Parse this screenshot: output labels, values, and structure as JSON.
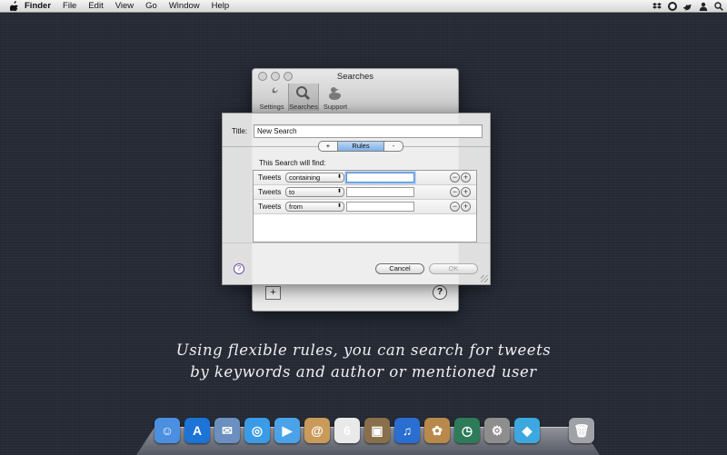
{
  "menubar": {
    "app_name": "Finder",
    "menus": [
      "File",
      "Edit",
      "View",
      "Go",
      "Window",
      "Help"
    ],
    "status_icons": [
      "dropbox-icon",
      "lifebuoy-icon",
      "bird-icon",
      "user-icon",
      "spotlight-icon"
    ]
  },
  "prefs_window": {
    "title": "Searches",
    "toolbar": [
      {
        "label": "Settings",
        "icon": "wrench-icon"
      },
      {
        "label": "Searches",
        "icon": "magnifier-icon"
      },
      {
        "label": "Support",
        "icon": "duck-icon"
      }
    ],
    "add_label": "+",
    "help_label": "?"
  },
  "sheet": {
    "title_label": "Title:",
    "title_value": "New Search",
    "segments": {
      "plus": "+",
      "rules": "Rules",
      "minus": "-"
    },
    "find_label": "This Search will find:",
    "rules": [
      {
        "label": "Tweets",
        "operator": "containing",
        "value": ""
      },
      {
        "label": "Tweets",
        "operator": "to",
        "value": ""
      },
      {
        "label": "Tweets",
        "operator": "from",
        "value": ""
      }
    ],
    "remove_label": "−",
    "add_label": "+",
    "help_label": "?",
    "cancel_label": "Cancel",
    "ok_label": "OK"
  },
  "caption": {
    "line1": "Using flexible rules, you can search for tweets",
    "line2": "by keywords and author or mentioned user"
  },
  "dock": {
    "apps": [
      {
        "name": "finder-icon",
        "glyph": "☺",
        "color": "#4a8fe0"
      },
      {
        "name": "app-store-icon",
        "glyph": "A",
        "color": "#1c74d6"
      },
      {
        "name": "mail-icon",
        "glyph": "✉",
        "color": "#6b8fbf"
      },
      {
        "name": "safari-icon",
        "glyph": "◎",
        "color": "#3a9be6"
      },
      {
        "name": "facetime-icon",
        "glyph": "▶",
        "color": "#4aa3e8"
      },
      {
        "name": "address-book-icon",
        "glyph": "@",
        "color": "#c99a5a"
      },
      {
        "name": "ical-icon",
        "glyph": "6",
        "color": "#e9e9e9"
      },
      {
        "name": "preview-icon",
        "glyph": "▣",
        "color": "#8a6f4c"
      },
      {
        "name": "itunes-icon",
        "glyph": "♫",
        "color": "#2b6ed1"
      },
      {
        "name": "iphoto-icon",
        "glyph": "✿",
        "color": "#b8894a"
      },
      {
        "name": "time-machine-icon",
        "glyph": "◷",
        "color": "#2e7b5a"
      },
      {
        "name": "system-preferences-icon",
        "glyph": "⚙",
        "color": "#8e8e8e"
      },
      {
        "name": "xcode-icon",
        "glyph": "◆",
        "color": "#3da7e0"
      }
    ],
    "trash": {
      "name": "trash-icon",
      "glyph": "🗑",
      "color": "#9fa3a8"
    }
  }
}
